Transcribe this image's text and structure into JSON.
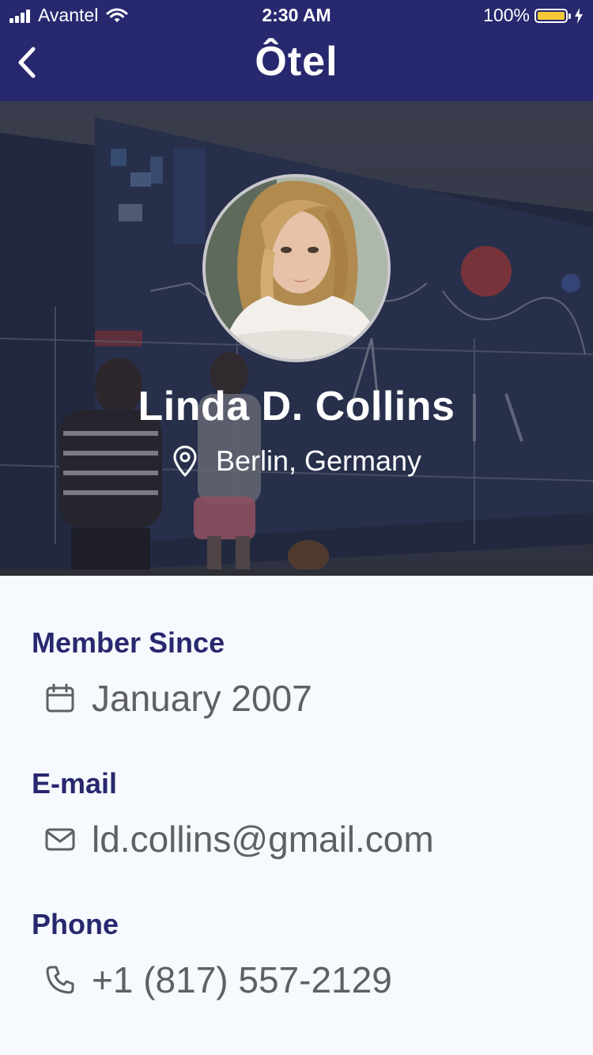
{
  "status_bar": {
    "carrier": "Avantel",
    "time": "2:30 AM",
    "battery_percent": "100%",
    "battery_level": 1.0,
    "battery_color": "#f7c837"
  },
  "nav": {
    "logo": "Ôtel",
    "back_icon": "chevron-left-icon",
    "bar_color": "#28286f"
  },
  "profile": {
    "name": "Linda D. Collins",
    "location": "Berlin, Germany",
    "location_icon": "map-pin-icon"
  },
  "details": [
    {
      "label": "Member Since",
      "value": "January 2007",
      "icon": "calendar-icon"
    },
    {
      "label": "E-mail",
      "value": "ld.collins@gmail.com",
      "icon": "mail-icon"
    },
    {
      "label": "Phone",
      "value": "+1 (817) 557-2129",
      "icon": "phone-icon"
    }
  ],
  "colors": {
    "accent": "#28286f",
    "value_text": "#5f5f66",
    "background": "#f6f9fd"
  }
}
